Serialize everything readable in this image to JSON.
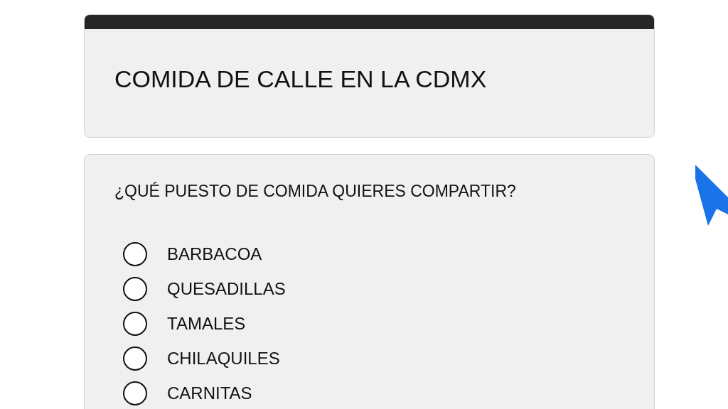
{
  "header": {
    "title": "COMIDA DE CALLE EN LA CDMX"
  },
  "question": {
    "text": "¿QUÉ PUESTO DE COMIDA QUIERES COMPARTIR?",
    "options": [
      {
        "label": "BARBACOA",
        "selected": false
      },
      {
        "label": "QUESADILLAS",
        "selected": false
      },
      {
        "label": "TAMALES",
        "selected": false
      },
      {
        "label": "CHILAQUILES",
        "selected": false
      },
      {
        "label": "CARNITAS",
        "selected": false
      }
    ]
  }
}
